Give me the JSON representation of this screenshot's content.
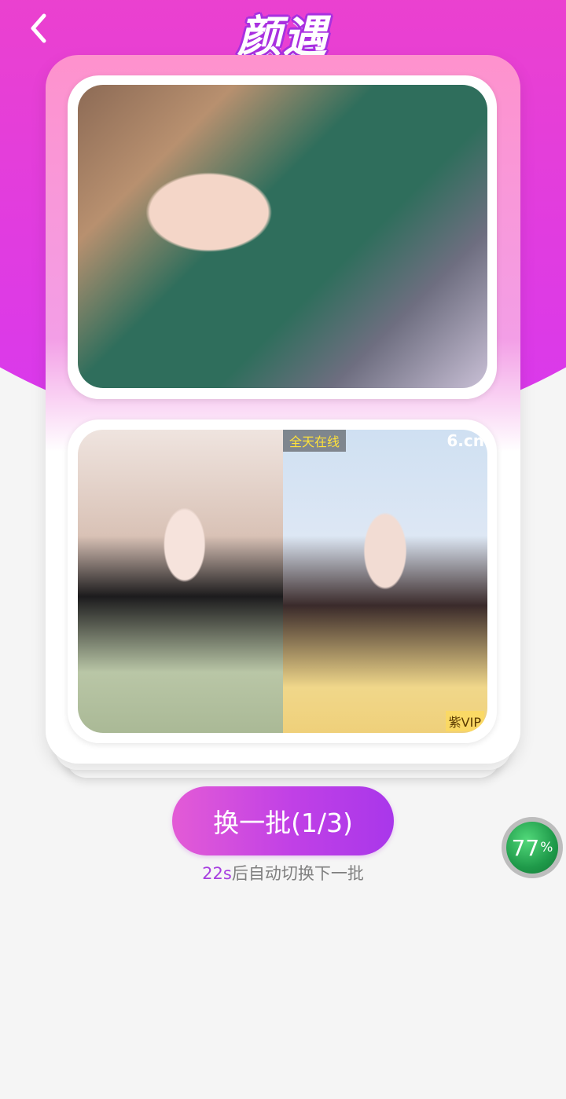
{
  "header": {
    "title": "颜遇",
    "back_icon": "chevron-left-icon"
  },
  "card": {
    "photo_main_alt": "",
    "photo_left_alt": "",
    "photo_right_alt": "",
    "tag_online": "全天在线",
    "tag_platform": "6.cn",
    "tag_vip": "紫VIP"
  },
  "actions": {
    "swap_label": "换一批(1/3)",
    "countdown_seconds": "22s",
    "countdown_text": "后自动切换下一批"
  },
  "floating": {
    "progress_percent": 77,
    "progress_value": "77",
    "progress_unit": "%"
  },
  "colors": {
    "accent": "#c040e6",
    "header_pink": "#ff58a8",
    "header_violet": "#d838ee",
    "progress_green": "#1f9a4a"
  }
}
